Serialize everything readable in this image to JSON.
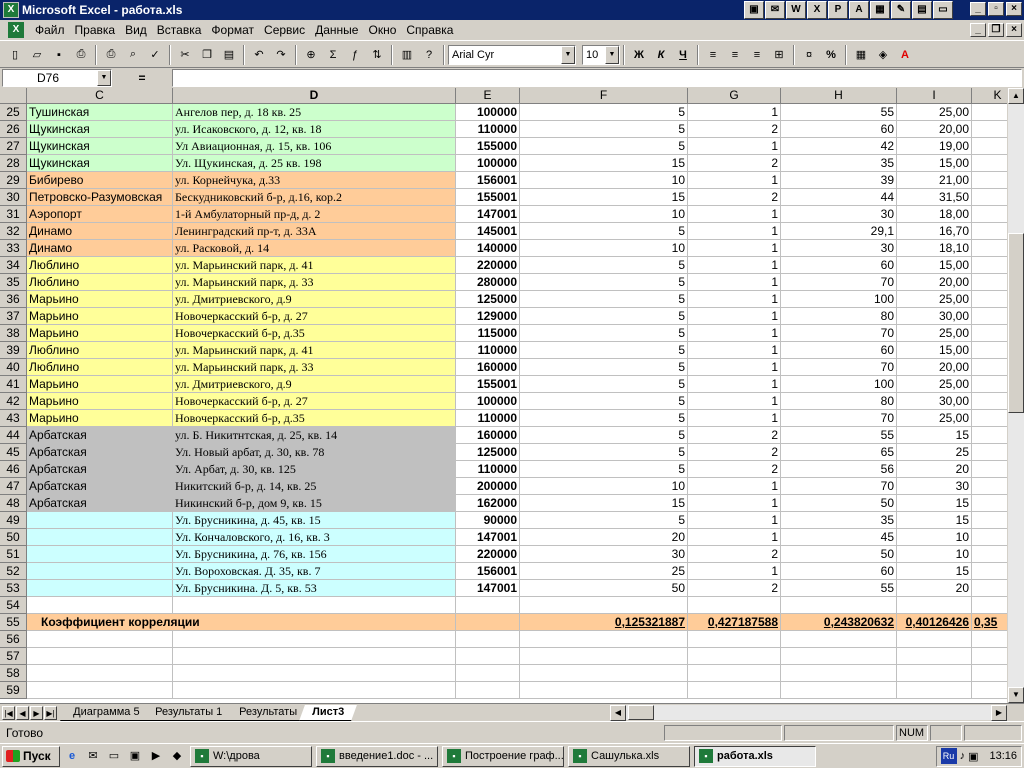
{
  "window": {
    "title": "Microsoft Excel - работа.xls"
  },
  "menu": [
    "Файл",
    "Правка",
    "Вид",
    "Вставка",
    "Формат",
    "Сервис",
    "Данные",
    "Окно",
    "Справка"
  ],
  "toolbar": {
    "font": "Arial Cyr",
    "size": "10",
    "bold": "Ж",
    "italic": "К",
    "underline": "Ч"
  },
  "formula_bar": {
    "cell_ref": "D76",
    "eq": "="
  },
  "columns": [
    "C",
    "D",
    "E",
    "F",
    "G",
    "H",
    "I",
    "K"
  ],
  "rows": [
    {
      "n": "25",
      "c": "Тушинская",
      "d": "Ангелов пер, д. 18 кв. 25",
      "e": "100000",
      "f": "5",
      "g": "1",
      "h": "55",
      "i": "25,00",
      "bg": "green"
    },
    {
      "n": "26",
      "c": "Щукинская",
      "d": "ул. Исаковского, д. 12, кв. 18",
      "e": "110000",
      "f": "5",
      "g": "2",
      "h": "60",
      "i": "20,00",
      "bg": "green"
    },
    {
      "n": "27",
      "c": "Щукинская",
      "d": "Ул Авиационная, д. 15, кв. 106",
      "e": "155000",
      "f": "5",
      "g": "1",
      "h": "42",
      "i": "19,00",
      "bg": "green"
    },
    {
      "n": "28",
      "c": "Щукинская",
      "d": "Ул. Щукинская, д. 25 кв. 198",
      "e": "100000",
      "f": "15",
      "g": "2",
      "h": "35",
      "i": "15,00",
      "bg": "green"
    },
    {
      "n": "29",
      "c": "Бибирево",
      "d": "ул. Корнейчука, д.33",
      "e": "156001",
      "f": "10",
      "g": "1",
      "h": "39",
      "i": "21,00",
      "bg": "orange"
    },
    {
      "n": "30",
      "c": "Петровско-Разумовская",
      "d": "Бескудниковский б-р, д.16, кор.2",
      "e": "155001",
      "f": "15",
      "g": "2",
      "h": "44",
      "i": "31,50",
      "bg": "orange"
    },
    {
      "n": "31",
      "c": "Аэропорт",
      "d": "1-й Амбулаторный пр-д, д. 2",
      "e": "147001",
      "f": "10",
      "g": "1",
      "h": "30",
      "i": "18,00",
      "bg": "orange"
    },
    {
      "n": "32",
      "c": "Динамо",
      "d": "Ленинградский пр-т, д. 33А",
      "e": "145001",
      "f": "5",
      "g": "1",
      "h": "29,1",
      "i": "16,70",
      "bg": "orange"
    },
    {
      "n": "33",
      "c": "Динамо",
      "d": "ул. Расковой, д. 14",
      "e": "140000",
      "f": "10",
      "g": "1",
      "h": "30",
      "i": "18,10",
      "bg": "orange"
    },
    {
      "n": "34",
      "c": "Люблино",
      "d": "ул. Марьинский парк, д. 41",
      "e": "220000",
      "f": "5",
      "g": "1",
      "h": "60",
      "i": "15,00",
      "bg": "yellow"
    },
    {
      "n": "35",
      "c": "Люблино",
      "d": "ул. Марьинский парк, д. 33",
      "e": "280000",
      "f": "5",
      "g": "1",
      "h": "70",
      "i": "20,00",
      "bg": "yellow"
    },
    {
      "n": "36",
      "c": "Марьино",
      "d": "ул. Дмитриевского, д.9",
      "e": "125000",
      "f": "5",
      "g": "1",
      "h": "100",
      "i": "25,00",
      "bg": "yellow"
    },
    {
      "n": "37",
      "c": "Марьино",
      "d": "Новочеркасский б-р, д. 27",
      "e": "129000",
      "f": "5",
      "g": "1",
      "h": "80",
      "i": "30,00",
      "bg": "yellow"
    },
    {
      "n": "38",
      "c": "Марьино",
      "d": "Новочеркасский б-р, д.35",
      "e": "115000",
      "f": "5",
      "g": "1",
      "h": "70",
      "i": "25,00",
      "bg": "yellow"
    },
    {
      "n": "39",
      "c": "Люблино",
      "d": "ул. Марьинский парк, д. 41",
      "e": "110000",
      "f": "5",
      "g": "1",
      "h": "60",
      "i": "15,00",
      "bg": "yellow"
    },
    {
      "n": "40",
      "c": "Люблино",
      "d": "ул. Марьинский парк, д. 33",
      "e": "160000",
      "f": "5",
      "g": "1",
      "h": "70",
      "i": "20,00",
      "bg": "yellow"
    },
    {
      "n": "41",
      "c": "Марьино",
      "d": "ул. Дмитриевского, д.9",
      "e": "155001",
      "f": "5",
      "g": "1",
      "h": "100",
      "i": "25,00",
      "bg": "yellow"
    },
    {
      "n": "42",
      "c": "Марьино",
      "d": "Новочеркасский б-р, д. 27",
      "e": "100000",
      "f": "5",
      "g": "1",
      "h": "80",
      "i": "30,00",
      "bg": "yellow"
    },
    {
      "n": "43",
      "c": "Марьино",
      "d": "Новочеркасский б-р, д.35",
      "e": "110000",
      "f": "5",
      "g": "1",
      "h": "70",
      "i": "25,00",
      "bg": "yellow"
    },
    {
      "n": "44",
      "c": "Арбатская",
      "d": "ул. Б. Никитнтская, д. 25, кв. 14",
      "e": "160000",
      "f": "5",
      "g": "2",
      "h": "55",
      "i": "15",
      "bg": "gray"
    },
    {
      "n": "45",
      "c": "Арбатская",
      "d": "Ул. Новый арбат, д. 30, кв. 78",
      "e": "125000",
      "f": "5",
      "g": "2",
      "h": "65",
      "i": "25",
      "bg": "gray"
    },
    {
      "n": "46",
      "c": "Арбатская",
      "d": "Ул. Арбат, д. 30, кв. 125",
      "e": "110000",
      "f": "5",
      "g": "2",
      "h": "56",
      "i": "20",
      "bg": "gray"
    },
    {
      "n": "47",
      "c": "Арбатская",
      "d": "Никитский б-р, д. 14, кв. 25",
      "e": "200000",
      "f": "10",
      "g": "1",
      "h": "70",
      "i": "30",
      "bg": "gray"
    },
    {
      "n": "48",
      "c": "Арбатская",
      "d": "Никинский б-р, дом 9, кв. 15",
      "e": "162000",
      "f": "15",
      "g": "1",
      "h": "50",
      "i": "15",
      "bg": "gray"
    },
    {
      "n": "49",
      "c": "",
      "d": "Ул. Брусникина, д. 45, кв. 15",
      "e": "90000",
      "f": "5",
      "g": "1",
      "h": "35",
      "i": "15",
      "bg": "cyan"
    },
    {
      "n": "50",
      "c": "",
      "d": "Ул. Кончаловского, д. 16, кв. 3",
      "e": "147001",
      "f": "20",
      "g": "1",
      "h": "45",
      "i": "10",
      "bg": "cyan"
    },
    {
      "n": "51",
      "c": "",
      "d": "Ул. Брусникина, д. 76, кв. 156",
      "e": "220000",
      "f": "30",
      "g": "2",
      "h": "50",
      "i": "10",
      "bg": "cyan"
    },
    {
      "n": "52",
      "c": "",
      "d": "Ул. Вороховская. Д. 35, кв. 7",
      "e": "156001",
      "f": "25",
      "g": "1",
      "h": "60",
      "i": "15",
      "bg": "cyan"
    },
    {
      "n": "53",
      "c": "",
      "d": "Ул. Брусникина. Д. 5, кв. 53",
      "e": "147001",
      "f": "50",
      "g": "2",
      "h": "55",
      "i": "20",
      "bg": "cyan"
    }
  ],
  "blank_rows_before": [
    "54"
  ],
  "corr_row": {
    "n": "55",
    "label": "Коэффициент корреляции",
    "f": "0,125321887",
    "g": "0,427187588",
    "h": "0,243820632",
    "i": "0,40126426",
    "k": "0,35"
  },
  "blank_rows_after": [
    "56",
    "57",
    "58",
    "59"
  ],
  "sheet_tabs": [
    {
      "label": "Диаграмма 5",
      "active": false
    },
    {
      "label": "Результаты 1",
      "active": false
    },
    {
      "label": "Результаты",
      "active": false
    },
    {
      "label": "Лист3",
      "active": true
    }
  ],
  "status": {
    "text": "Готово",
    "num": "NUM"
  },
  "taskbar": {
    "start": "Пуск",
    "tasks": [
      {
        "label": "W:\\дрова",
        "active": false
      },
      {
        "label": "введение1.doc - ...",
        "active": false
      },
      {
        "label": "Построение граф...",
        "active": false
      },
      {
        "label": "Сашулька.xls",
        "active": false
      },
      {
        "label": "работа.xls",
        "active": true
      }
    ],
    "lang": "Ru",
    "clock": "13:16"
  }
}
